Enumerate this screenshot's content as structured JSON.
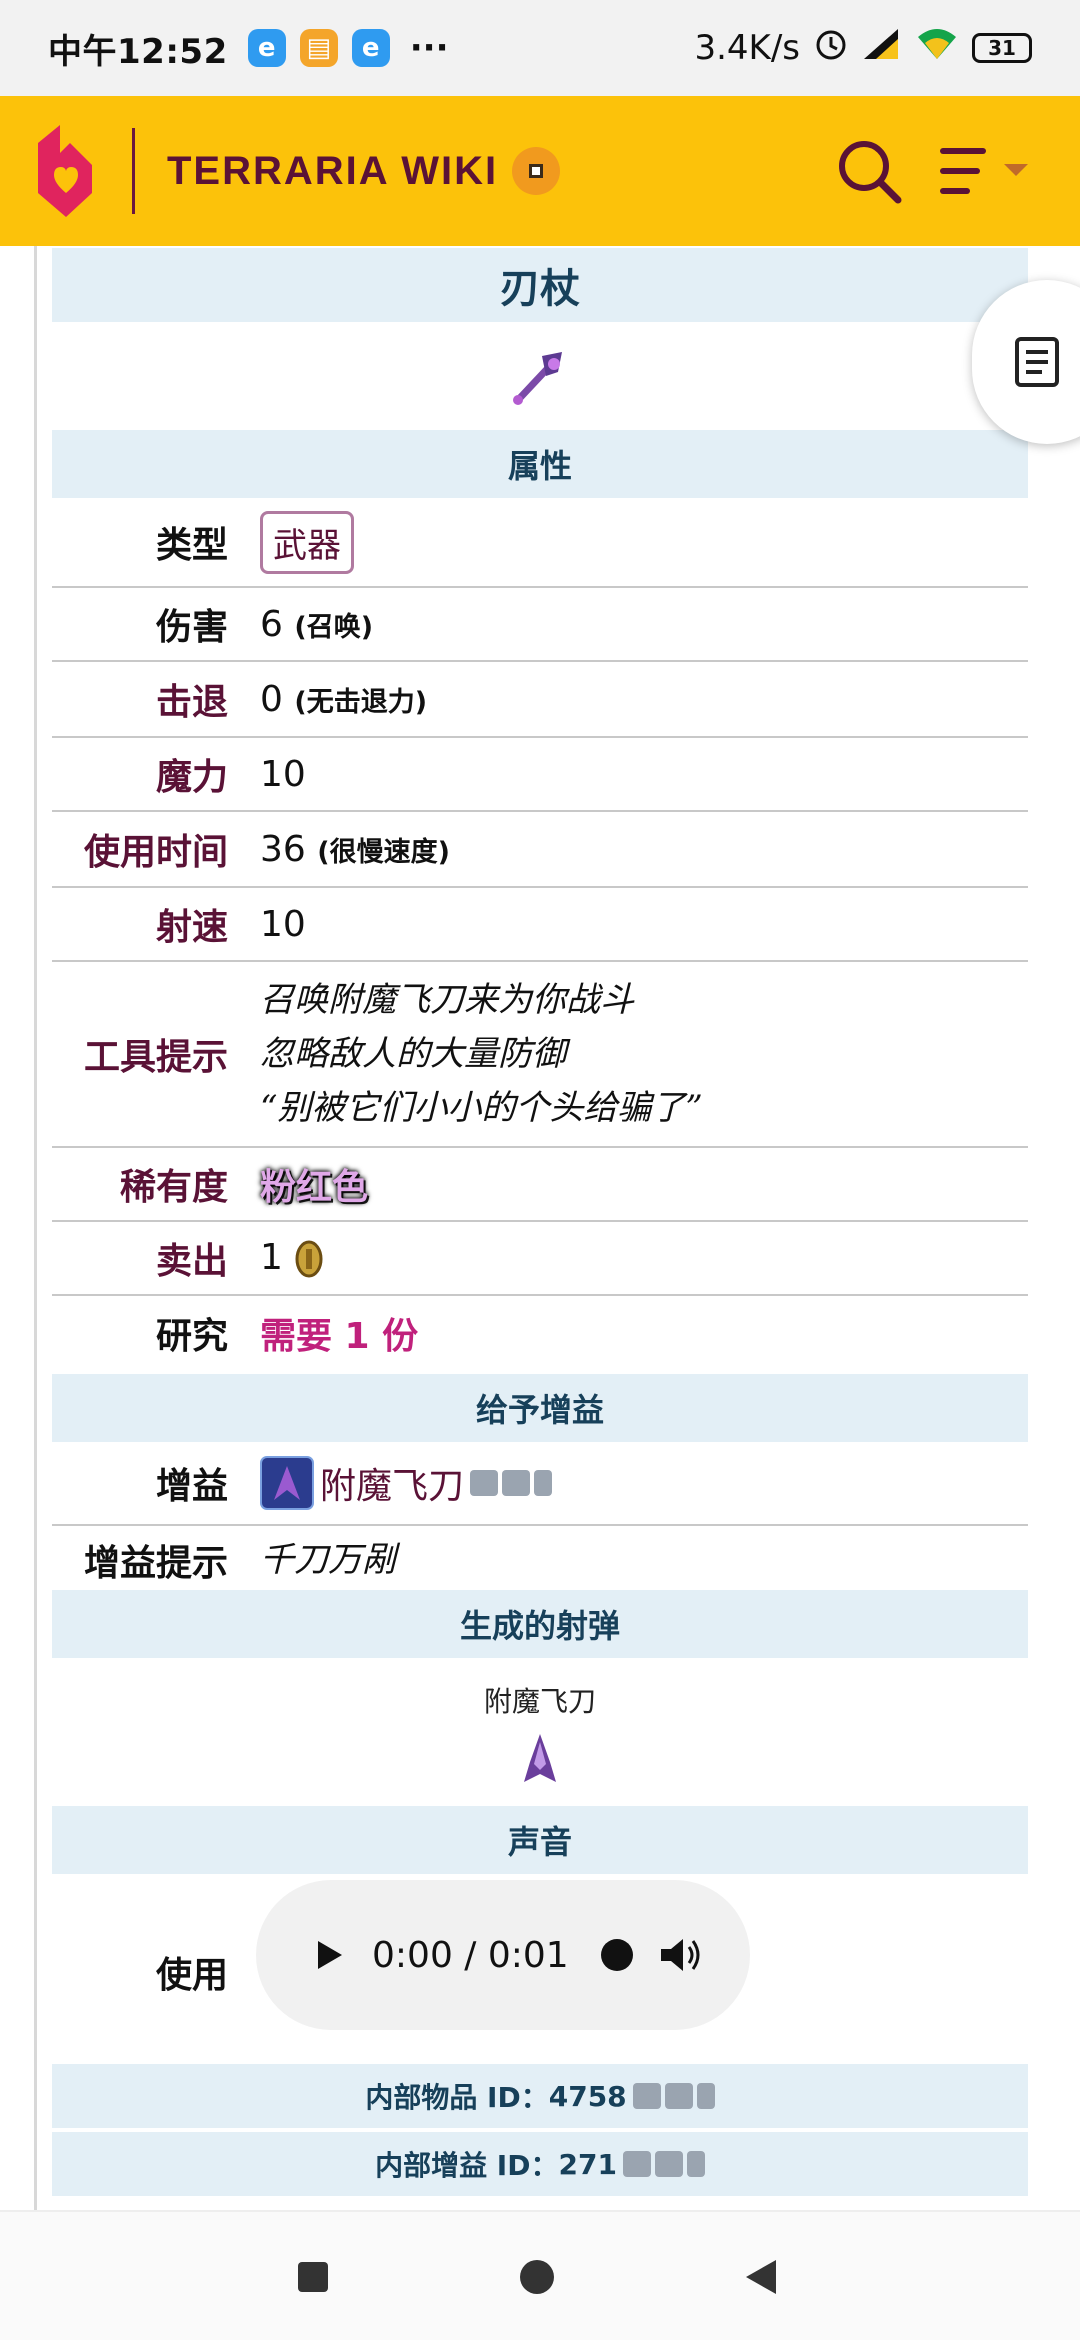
{
  "status_bar": {
    "time": "中午12:52",
    "dots": "···",
    "net_speed": "3.4K/s",
    "battery": "31"
  },
  "header": {
    "brand": "TERRARIA WIKI"
  },
  "infobox": {
    "title": "刃杖",
    "sections": {
      "attributes": "属性",
      "buffs": "给予增益",
      "projectiles": "生成的射弹",
      "sound": "声音"
    },
    "rows": {
      "type_label": "类型",
      "type_value": "武器",
      "damage_label": "伤害",
      "damage_value": "6",
      "damage_note": "(召唤)",
      "knockback_label": "击退",
      "knockback_value": "0",
      "knockback_note": "(无击退力)",
      "mana_label": "魔力",
      "mana_value": "10",
      "usetime_label": "使用时间",
      "usetime_value": "36",
      "usetime_note": "(很慢速度)",
      "velocity_label": "射速",
      "velocity_value": "10",
      "tooltip_label": "工具提示",
      "tooltip_lines": [
        "召唤附魔飞刀来为你战斗",
        "忽略敌人的大量防御",
        "“别被它们小小的个头给骗了”"
      ],
      "rarity_label": "稀有度",
      "rarity_value": "粉红色",
      "sell_label": "卖出",
      "sell_value": "1",
      "research_label": "研究",
      "research_value": "需要 1 份",
      "buff_label": "增益",
      "buff_value": "附魔飞刀",
      "bufftip_label": "增益提示",
      "bufftip_value": "千刀万剐"
    },
    "projectile_name": "附魔飞刀",
    "sound_label": "使用",
    "audio_time": "0:00 / 0:01",
    "footer": {
      "item_id_label": "内部物品 ID：",
      "item_id": "4758",
      "buff_id_label": "内部增益 ID：",
      "buff_id": "271"
    }
  },
  "colors": {
    "header_bg": "#fcc20a",
    "brand": "#5a1236",
    "section_bg": "#e3eff6",
    "label": "#5a1236",
    "research": "#c0217c"
  }
}
